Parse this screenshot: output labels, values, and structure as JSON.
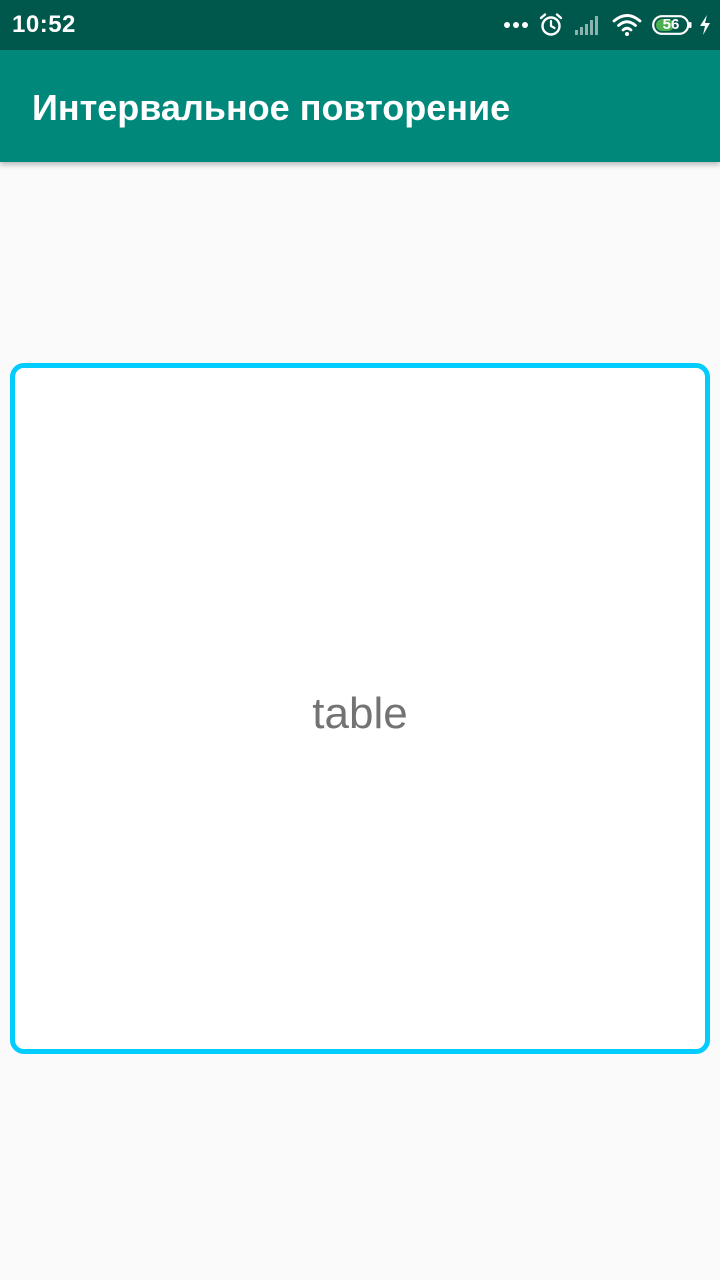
{
  "status_bar": {
    "time": "10:52",
    "icons": [
      "more-dots-icon",
      "alarm-icon",
      "signal-icon",
      "wifi-icon",
      "battery-icon",
      "charging-bolt-icon"
    ],
    "battery_level": "56",
    "color": "#00574b"
  },
  "app_bar": {
    "title": "Интервальное повторение",
    "color": "#00897b"
  },
  "card": {
    "word": "table",
    "border_color": "#00ccff",
    "text_color": "#737373"
  }
}
